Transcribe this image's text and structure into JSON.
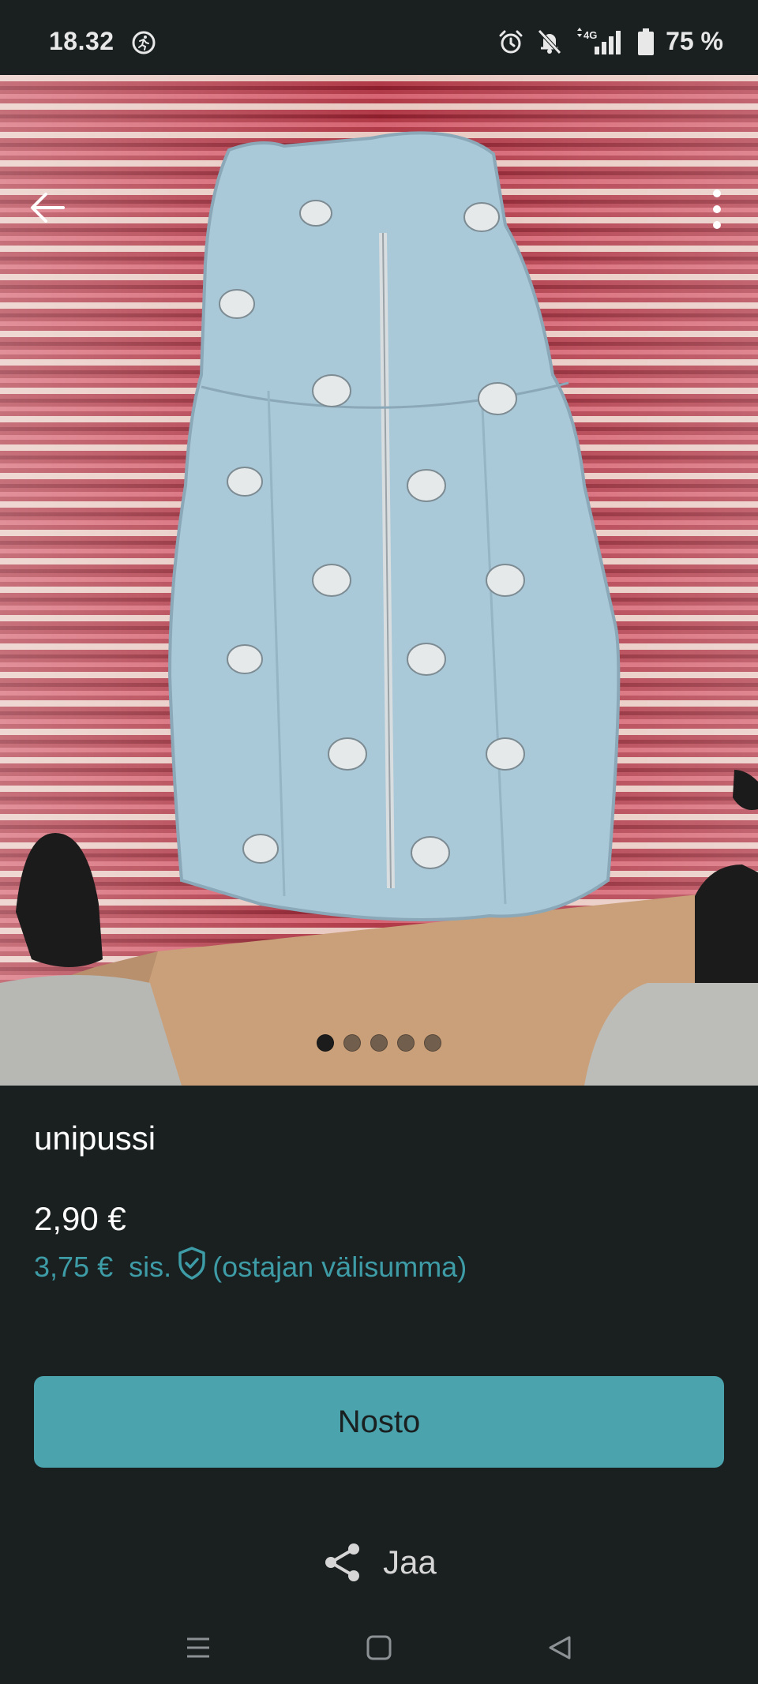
{
  "status_bar": {
    "time": "18.32",
    "battery": "75 %",
    "network": "4G"
  },
  "listing": {
    "title": "unipussi",
    "price": "2,90 €",
    "buyer_price": "3,75 €",
    "buyer_price_prefix": "sis.",
    "buyer_price_suffix": "(ostajan välisumma)",
    "image_count": 5,
    "active_image": 1
  },
  "actions": {
    "pickup_label": "Nosto",
    "share_label": "Jaa"
  },
  "colors": {
    "accent": "#4aa3ad",
    "accent_text": "#3d9ca6",
    "background": "#1a1f20"
  }
}
